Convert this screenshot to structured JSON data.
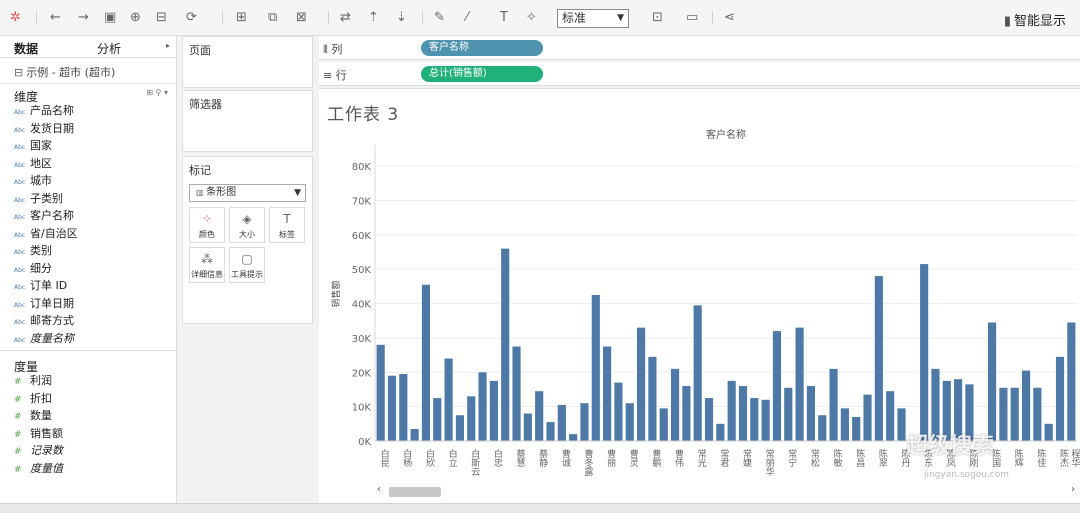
{
  "toolbar": {
    "mark_type_value": "标准",
    "smart_show": "智能显示"
  },
  "data_pane": {
    "tab_data": "数据",
    "tab_analysis": "分析",
    "datasource": "示例 - 超市 (超市)",
    "dimensions_header": "维度",
    "dimensions": [
      "产品名称",
      "发货日期",
      "国家",
      "地区",
      "城市",
      "子类别",
      "客户名称",
      "省/自治区",
      "类别",
      "细分",
      "订单 ID",
      "订单日期",
      "邮寄方式",
      "度量名称"
    ],
    "measures_header": "度量",
    "measures": [
      "利润",
      "折扣",
      "数量",
      "销售额",
      "记录数",
      "度量值"
    ]
  },
  "cards": {
    "pages": "页面",
    "filters": "筛选器",
    "marks": "标记",
    "marks_type": "条形图",
    "buttons": [
      "颜色",
      "大小",
      "标签",
      "详细信息",
      "工具提示"
    ]
  },
  "shelves": {
    "columns_label": "列",
    "columns_pill": "客户名称",
    "rows_label": "行",
    "rows_pill": "总计(销售额)",
    "columns_color": "#4f93ae",
    "rows_color": "#20b07a"
  },
  "view": {
    "sheet_title": "工作表 3"
  },
  "watermark": "超级搜索",
  "watermark_sub": "jingyan.sogou.com",
  "chart_data": {
    "type": "bar",
    "title": "客户名称",
    "ylabel": "销售额",
    "ylim": [
      0,
      85000
    ],
    "yticks": [
      0,
      10000,
      20000,
      30000,
      40000,
      50000,
      60000,
      70000,
      80000
    ],
    "ytick_labels": [
      "0K",
      "10K",
      "20K",
      "30K",
      "40K",
      "50K",
      "60K",
      "70K",
      "80K"
    ],
    "bar_color": "#4e79a7",
    "grid": true,
    "values": [
      28000,
      19000,
      19500,
      3500,
      45500,
      12500,
      24000,
      7500,
      13000,
      20000,
      17500,
      56000,
      27500,
      8000,
      14500,
      5500,
      10500,
      2000,
      11000,
      42500,
      27500,
      17000,
      11000,
      33000,
      24500,
      9500,
      21000,
      16000,
      39500,
      12500,
      5000,
      17500,
      16000,
      12500,
      12000,
      32000,
      15500,
      33000,
      16000,
      7500,
      21000,
      9500,
      7000,
      13500,
      48000,
      14500,
      9500,
      0,
      51500,
      21000,
      17500,
      18000,
      16500,
      0,
      34500,
      15500,
      15500,
      20500,
      15500,
      5000,
      24500,
      34500
    ],
    "x_tick_labels": [
      {
        "i": 0,
        "text": "白昆"
      },
      {
        "i": 2,
        "text": "白杨"
      },
      {
        "i": 4,
        "text": "白欣"
      },
      {
        "i": 6,
        "text": "白立"
      },
      {
        "i": 8,
        "text": "白斯云"
      },
      {
        "i": 10,
        "text": "白忠"
      },
      {
        "i": 12,
        "text": "蔡慧"
      },
      {
        "i": 14,
        "text": "蔡静"
      },
      {
        "i": 16,
        "text": "曹诚"
      },
      {
        "i": 18,
        "text": "曹冬露"
      },
      {
        "i": 20,
        "text": "曹丽"
      },
      {
        "i": 22,
        "text": "曹灵"
      },
      {
        "i": 24,
        "text": "曹鹏"
      },
      {
        "i": 26,
        "text": "曹伟"
      },
      {
        "i": 28,
        "text": "常光"
      },
      {
        "i": 30,
        "text": "常君"
      },
      {
        "i": 32,
        "text": "常婕"
      },
      {
        "i": 34,
        "text": "常丽华"
      },
      {
        "i": 36,
        "text": "常宁"
      },
      {
        "i": 38,
        "text": "常松"
      },
      {
        "i": 40,
        "text": "陈敏"
      },
      {
        "i": 42,
        "text": "陈昌"
      },
      {
        "i": 44,
        "text": "陈翠"
      },
      {
        "i": 46,
        "text": "陈丹"
      },
      {
        "i": 48,
        "text": "陈东"
      },
      {
        "i": 50,
        "text": "陈凤"
      },
      {
        "i": 52,
        "text": "陈刚"
      },
      {
        "i": 54,
        "text": "陈国"
      },
      {
        "i": 56,
        "text": "陈辉"
      },
      {
        "i": 58,
        "text": "陈佳"
      },
      {
        "i": 60,
        "text": "陈杰"
      },
      {
        "i": 61,
        "text": "程华"
      }
    ]
  }
}
